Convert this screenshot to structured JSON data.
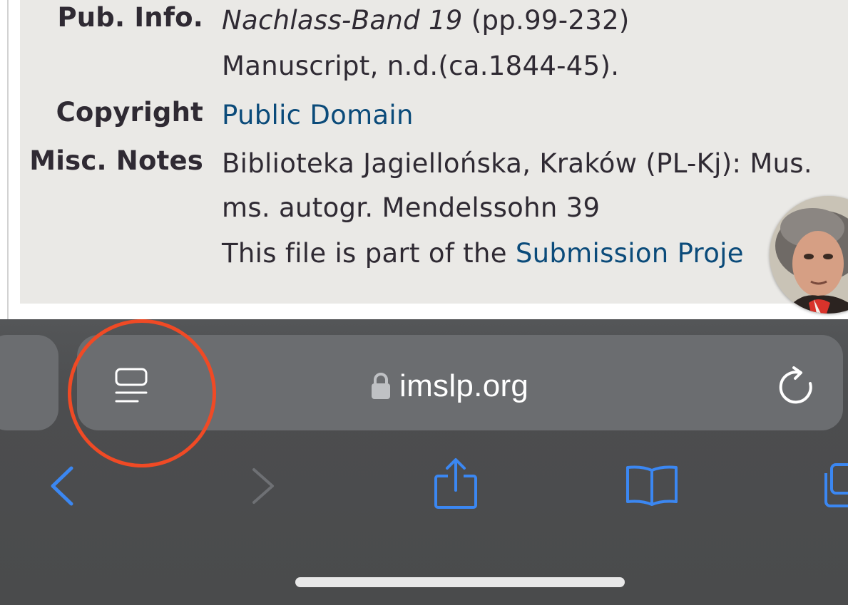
{
  "infobox": {
    "pub_info": {
      "label": "Pub. Info.",
      "title": "Nachlass-Band 19",
      "pages": "(pp.99-232)",
      "line2": "Manuscript, n.d.(ca.1844-45)."
    },
    "copyright": {
      "label": "Copyright",
      "value": "Public Domain"
    },
    "misc_notes": {
      "label": "Misc. Notes",
      "line1": "Biblioteka Jagiellońska, Kraków (PL-Kj): Mus.",
      "line2": "ms. autogr. Mendelssohn 39",
      "line3_prefix": "This file is part of the ",
      "line3_link": "Submission Proje"
    }
  },
  "browser": {
    "url": "imslp.org",
    "icons": {
      "page_menu": "page-menu-icon",
      "lock": "lock-icon",
      "reload": "reload-icon",
      "back": "chevron-left-icon",
      "forward": "chevron-right-icon",
      "share": "share-icon",
      "bookmarks": "book-icon",
      "tabs": "tabs-icon"
    }
  },
  "colors": {
    "accent": "#3b87f2",
    "disabled": "#6e7074",
    "highlight": "#f04a25",
    "link": "#0b4b7a"
  }
}
